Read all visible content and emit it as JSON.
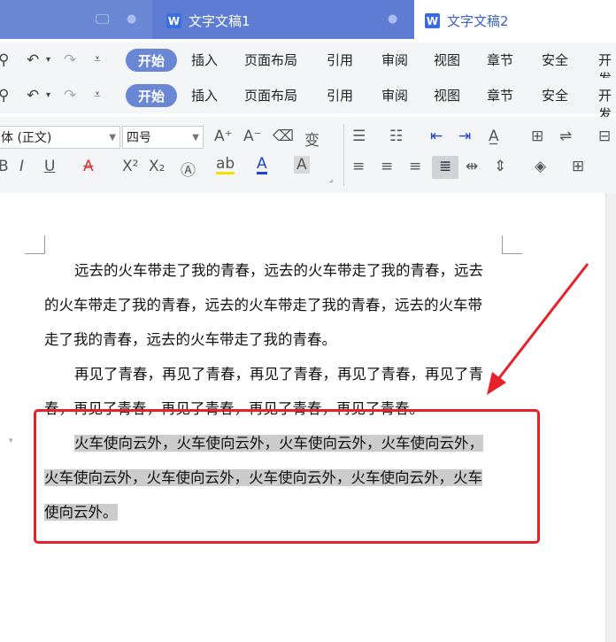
{
  "tabs": [
    {
      "title": "",
      "dot": "●"
    },
    {
      "logo": "W",
      "title": "文字文稿1",
      "dot": "●"
    },
    {
      "logo": "W",
      "title": "文字文稿2"
    }
  ],
  "menu": {
    "active": "开始",
    "items": [
      "插入",
      "页面布局",
      "引用",
      "审阅",
      "视图",
      "章节",
      "安全",
      "开发"
    ]
  },
  "ribbon": {
    "font_name": "宋体 (正文)",
    "font_size": "四号",
    "font_name_visible": "体 (正文)"
  },
  "document": {
    "paragraphs": [
      {
        "lines": [
          "远去的火车带走了我的青春，远去的火车带走了我的青春，远去",
          "的火车带走了我的青春，远去的火车带走了我的青春，远去的火车带",
          "走了我的青春，远去的火车带走了我的青春。"
        ]
      },
      {
        "lines": [
          "再见了青春，再见了青春，再见了青春，再见了青春，再见了青",
          "春，再见了青春，再见了青春，再见了青春，再见了青春。"
        ]
      },
      {
        "lines": [
          "火车使向云外，火车使向云外，火车使向云外，火车使向云外，",
          "火车使向云外，火车使向云外，火车使向云外，火车使向云外，火车",
          "使向云外。"
        ]
      }
    ]
  },
  "colors": {
    "tabbar": "#6a87d6",
    "highlight": "#cccccc",
    "annotation": "#e8202a"
  }
}
